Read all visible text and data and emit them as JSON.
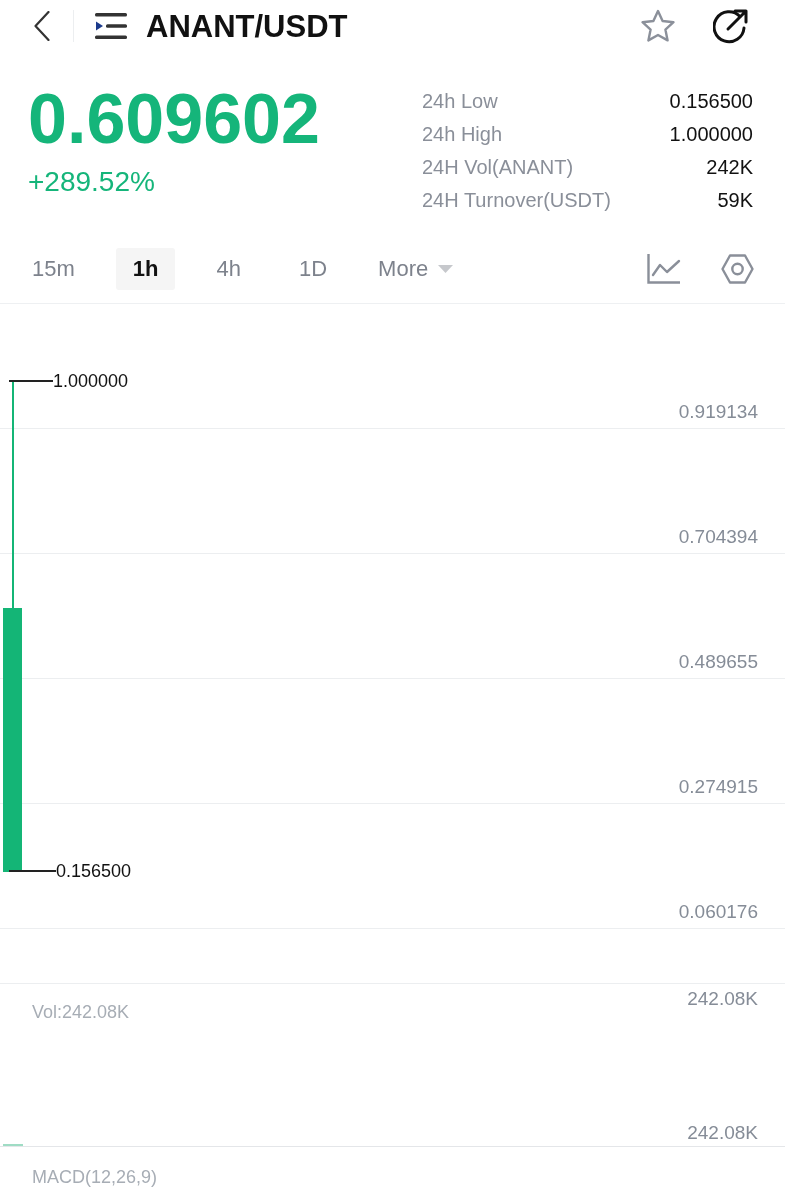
{
  "header": {
    "title": "ANANT/USDT"
  },
  "price": {
    "last": "0.609602",
    "change": "+289.52%"
  },
  "stats": [
    {
      "label": "24h Low",
      "value": "0.156500"
    },
    {
      "label": "24h High",
      "value": "1.000000"
    },
    {
      "label": "24H Vol(ANANT)",
      "value": "242K"
    },
    {
      "label": "24H Turnover(USDT)",
      "value": "59K"
    }
  ],
  "timeframes": [
    {
      "label": "15m",
      "selected": false,
      "kind": "interval"
    },
    {
      "label": "1h",
      "selected": true,
      "kind": "interval"
    },
    {
      "label": "4h",
      "selected": false,
      "kind": "interval"
    },
    {
      "label": "1D",
      "selected": false,
      "kind": "interval"
    },
    {
      "label": "More",
      "selected": false,
      "kind": "dropdown"
    }
  ],
  "chart": {
    "price_axis": [
      "0.919134",
      "0.704394",
      "0.489655",
      "0.274915",
      "0.060176"
    ],
    "high_marker": "1.000000",
    "low_marker": "0.156500"
  },
  "volume": {
    "label": "Vol:242.08K",
    "axis": [
      "242.08K",
      "242.08K"
    ]
  },
  "macd": {
    "label": "MACD(12,26,9)"
  }
}
